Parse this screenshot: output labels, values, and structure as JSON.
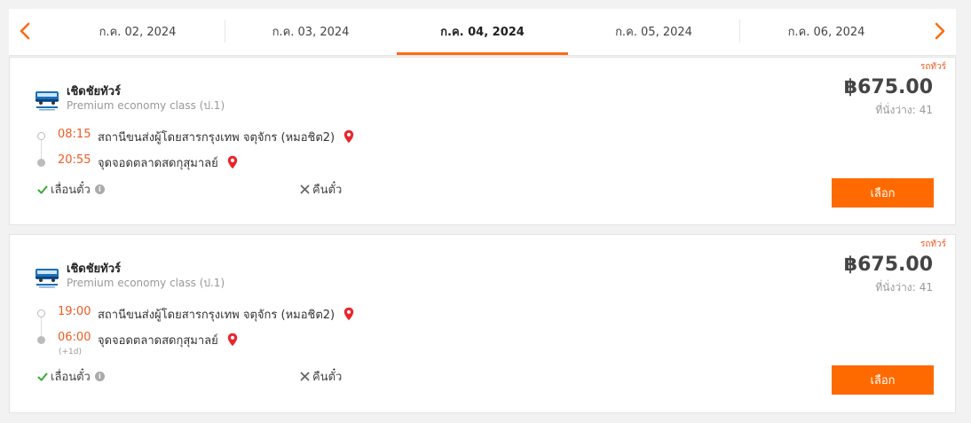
{
  "date_tabs": [
    {
      "label": "ก.ค. 02, 2024"
    },
    {
      "label": "ก.ค. 03, 2024"
    },
    {
      "label": "ก.ค. 04, 2024"
    },
    {
      "label": "ก.ค. 05, 2024"
    },
    {
      "label": "ก.ค. 06, 2024"
    }
  ],
  "active_tab_index": 2,
  "colors": {
    "accent": "#ff6a13",
    "time": "#f05a22",
    "pin": "#e8262b",
    "check": "#3aaa35"
  },
  "trips": [
    {
      "tag": "รถทัวร์",
      "operator": "เชิดชัยทัวร์",
      "bus_class": "Premium economy class (ป.1)",
      "price": "฿675.00",
      "seats_label": "ที่นั่งว่าง:",
      "seats_count": "41",
      "departure_time": "08:15",
      "departure_place": "สถานีขนส่งผู้โดยสารกรุงเทพ จตุจักร (หมอชิต2)",
      "arrival_time": "20:55",
      "arrival_place": "จุดจอดตลาดสดกุสุมาลย์",
      "arrival_day_offset": "",
      "change_ticket": "เลื่อนตั๋ว",
      "refund": "คืนตั๋ว",
      "select_label": "เลือก"
    },
    {
      "tag": "รถทัวร์",
      "operator": "เชิดชัยทัวร์",
      "bus_class": "Premium economy class (ป.1)",
      "price": "฿675.00",
      "seats_label": "ที่นั่งว่าง:",
      "seats_count": "41",
      "departure_time": "19:00",
      "departure_place": "สถานีขนส่งผู้โดยสารกรุงเทพ จตุจักร (หมอชิต2)",
      "arrival_time": "06:00",
      "arrival_place": "จุดจอดตลาดสดกุสุมาลย์",
      "arrival_day_offset": "(+1d)",
      "change_ticket": "เลื่อนตั๋ว",
      "refund": "คืนตั๋ว",
      "select_label": "เลือก"
    }
  ]
}
